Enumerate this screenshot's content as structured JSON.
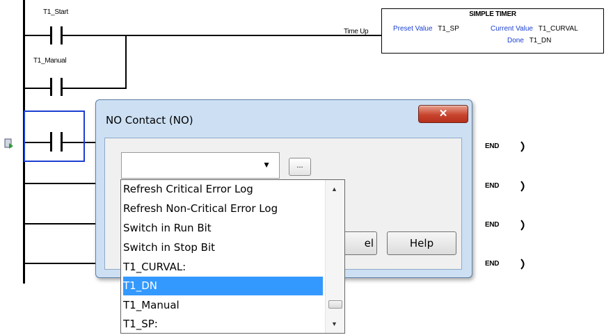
{
  "ladder": {
    "contact_top": "T1_Start",
    "contact_branch": "T1_Manual",
    "output_label": "Time Up",
    "end_labels": [
      "END",
      "END",
      "END",
      "END"
    ]
  },
  "timer": {
    "title": "SIMPLE TIMER",
    "preset_label": "Preset Value",
    "preset_value": "T1_SP",
    "current_label": "Current Value",
    "current_value": "T1_CURVAL",
    "done_label": "Done",
    "done_value": "T1_DN"
  },
  "dialog": {
    "title": "NO Contact (NO)",
    "close_glyph": "✕",
    "combo_value": "",
    "browse_label": "...",
    "cancel_label_visible": "el",
    "help_label": "Help"
  },
  "dropdown": {
    "items": [
      "Refresh Critical Error Log",
      "Refresh Non-Critical Error Log",
      "Switch in Run Bit",
      "Switch in Stop Bit",
      "T1_CURVAL:",
      "T1_DN",
      "T1_Manual",
      "T1_SP:"
    ],
    "selected_index": 5
  },
  "colors": {
    "selection_blue": "#3399ff",
    "label_blue": "#1a3fd1",
    "dialog_frame": "#cde0f3",
    "close_red": "#c8452f"
  }
}
